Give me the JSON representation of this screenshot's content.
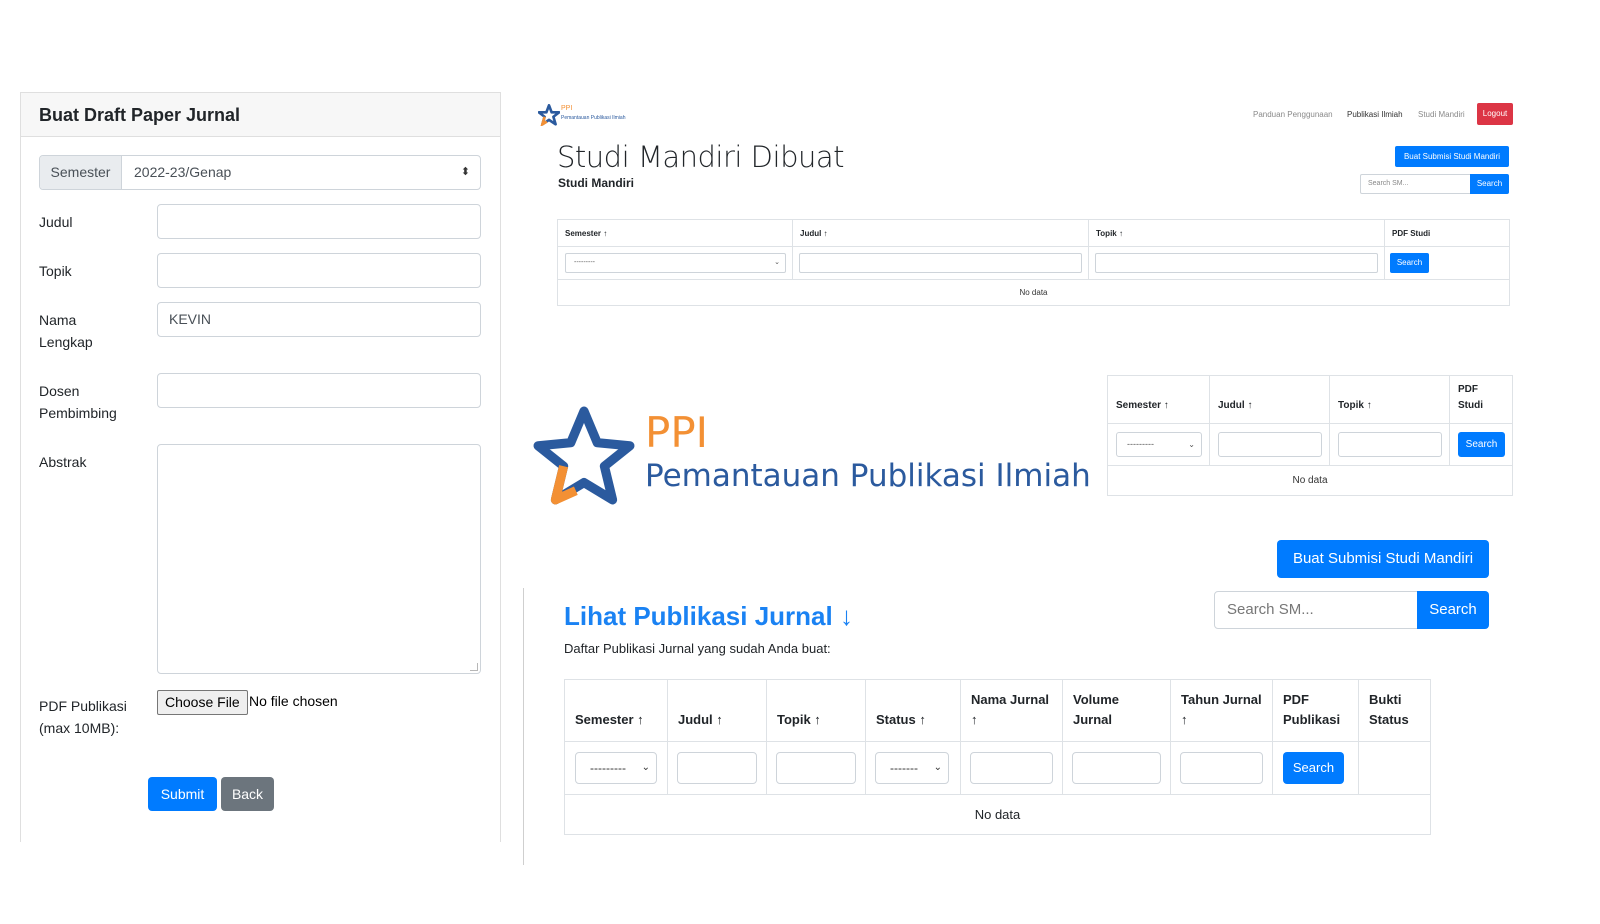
{
  "draft_form": {
    "title": "Buat Draft Paper Jurnal",
    "semester_label": "Semester",
    "semester_value": "2022-23/Genap",
    "judul_label": "Judul",
    "topik_label": "Topik",
    "nama_label": "Nama Lengkap",
    "nama_value": "KEVIN",
    "dosen_label": "Dosen Pembimbing",
    "abstrak_label": "Abstrak",
    "pdf_label": "PDF Publikasi (max 10MB):",
    "choose_file_label": "Choose File",
    "no_file_text": "No file chosen",
    "submit_label": "Submit",
    "back_label": "Back"
  },
  "mini_page": {
    "logo_ppi": "PPI",
    "logo_sub": "Pemantauan Publikasi Ilmiah",
    "nav": [
      "Panduan Penggunaan",
      "Publikasi Ilmiah",
      "Studi Mandiri"
    ],
    "logout_label": "Logout",
    "title": "Studi Mandiri Dibuat",
    "subtitle": "Studi Mandiri",
    "buat_button": "Buat Submisi Studi Mandiri",
    "search_placeholder": "Search SM...",
    "search_button": "Search",
    "table": {
      "headers": [
        "Semester ↑",
        "Judul ↑",
        "Topik ↑",
        "PDF Studi"
      ],
      "semester_filter": "---------",
      "search_button": "Search",
      "empty_text": "No data"
    }
  },
  "big_logo": {
    "ppi": "PPI",
    "subtitle": "Pemantauan Publikasi Ilmiah"
  },
  "mid_table": {
    "headers": [
      "Semester ↑",
      "Judul ↑",
      "Topik ↑",
      "PDF Studi"
    ],
    "semester_filter": "---------",
    "search_button": "Search",
    "empty_text": "No data"
  },
  "publikasi": {
    "buat_button": "Buat Submisi Studi Mandiri",
    "search_placeholder": "Search SM...",
    "search_button": "Search",
    "title": "Lihat Publikasi Jurnal ↓",
    "description": "Daftar Publikasi Jurnal yang sudah Anda buat:",
    "table": {
      "headers": [
        "Semester ↑",
        "Judul ↑",
        "Topik ↑",
        "Status ↑",
        "Nama Jurnal ↑",
        "Volume Jurnal",
        "Tahun Jurnal ↑",
        "PDF Publikasi",
        "Bukti Status"
      ],
      "semester_filter": "---------",
      "status_filter": "-------",
      "search_button": "Search",
      "empty_text": "No data"
    }
  },
  "colors": {
    "primary": "#007bff",
    "secondary": "#6c757d",
    "danger": "#dc3545",
    "title_blue": "#1a82f3",
    "logo_orange": "#f39034",
    "logo_blue": "#2b5a9e"
  }
}
